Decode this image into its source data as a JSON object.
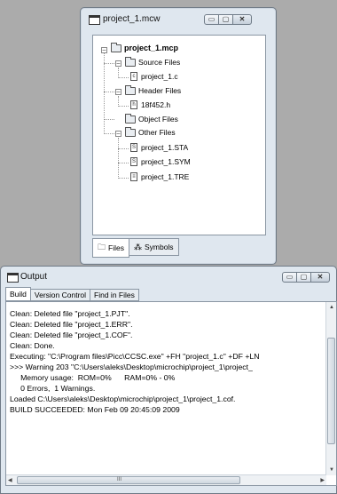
{
  "project_window": {
    "title": "project_1.mcw",
    "tree": {
      "root": "project_1.mcp",
      "source_files": "Source Files",
      "source_file_1": "project_1.c",
      "header_files": "Header Files",
      "header_file_1": "18f452.h",
      "object_files": "Object Files",
      "other_files": "Other Files",
      "other_file_1": "project_1.STA",
      "other_file_2": "project_1.SYM",
      "other_file_3": "project_1.TRE"
    },
    "tabs": {
      "files": "Files",
      "symbols": "Symbols"
    }
  },
  "output_window": {
    "title": "Output",
    "tabs": {
      "build": "Build",
      "version_control": "Version Control",
      "find_in_files": "Find in Files"
    },
    "log": [
      "Clean: Deleted file \"project_1.PJT\".",
      "Clean: Deleted file \"project_1.ERR\".",
      "Clean: Deleted file \"project_1.COF\".",
      "Clean: Done.",
      "Executing: \"C:\\Program files\\Picc\\CCSC.exe\" +FH \"project_1.c\" +DF +LN",
      ">>> Warning 203 \"C:\\Users\\aleks\\Desktop\\microchip\\project_1\\project_",
      "     Memory usage:  ROM=0%      RAM=0% - 0%",
      "     0 Errors,  1 Warnings.",
      "Loaded C:\\Users\\aleks\\Desktop\\microchip\\project_1\\project_1.cof.",
      "BUILD SUCCEEDED: Mon Feb 09 20:45:09 2009"
    ],
    "hscroll_marker": "III"
  },
  "window_buttons": {
    "minimize": "▭",
    "maximize": "▢",
    "close": "✕"
  }
}
